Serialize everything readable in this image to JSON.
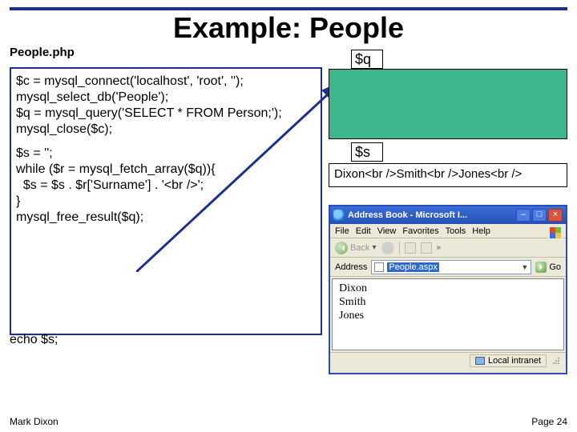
{
  "title": "Example: People",
  "filename": "People.php",
  "code": {
    "l1": "$c = mysql_connect('localhost', 'root', '');",
    "l2": "mysql_select_db('People');",
    "l3": "$q = mysql_query('SELECT * FROM Person;');",
    "l4": "mysql_close($c);",
    "l5": "$s = '';",
    "l6": "while ($r = mysql_fetch_array($q)){",
    "l7": "  $s = $s . $r['Surname'] . '<br />';",
    "l8": "}",
    "l9": "mysql_free_result($q);",
    "l10": "echo $s;"
  },
  "labels": {
    "q": "$q",
    "s": "$s"
  },
  "sbox": "Dixon<br />Smith<br />Jones<br />",
  "ie": {
    "title": "Address Book - Microsoft I...",
    "menu": {
      "file": "File",
      "edit": "Edit",
      "view": "View",
      "fav": "Favorites",
      "tools": "Tools",
      "help": "Help"
    },
    "back": "Back",
    "addr_label": "Address",
    "addr_value": "People.aspx",
    "go": "Go",
    "lines": {
      "r1": "Dixon",
      "r2": "Smith",
      "r3": "Jones"
    },
    "status": "Local intranet"
  },
  "footer": {
    "left": "Mark Dixon",
    "right": "Page 24"
  }
}
